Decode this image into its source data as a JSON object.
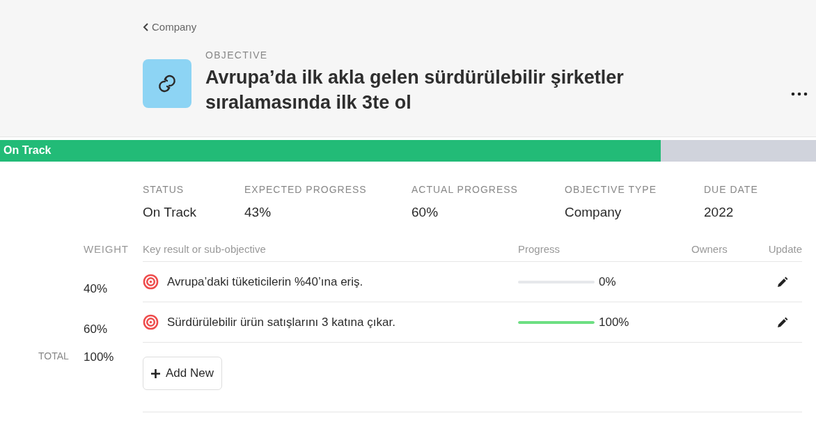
{
  "breadcrumb": {
    "label": "Company"
  },
  "objective": {
    "eyebrow": "OBJECTIVE",
    "title": "Avrupa’da ilk akla gelen sürdürülebilir şirketler sıralamasında ilk 3te ol"
  },
  "status_bar": {
    "label": "On Track",
    "level": 0.81
  },
  "summary": [
    {
      "label": "STATUS",
      "value": "On Track"
    },
    {
      "label": "EXPECTED PROGRESS",
      "value": "43%"
    },
    {
      "label": "ACTUAL PROGRESS",
      "value": "60%"
    },
    {
      "label": "OBJECTIVE TYPE",
      "value": "Company"
    },
    {
      "label": "DUE DATE",
      "value": "2022"
    }
  ],
  "table": {
    "columns": [
      "WEIGHT",
      "Key result or sub-objective",
      "Progress",
      "Owners",
      "Update"
    ],
    "rows": [
      {
        "weight": "40%",
        "title": "Avrupa’daki tüketicilerin %40’ına eriş.",
        "level": 0,
        "reading": "0%"
      },
      {
        "weight": "60%",
        "title": "Sürdürülebilir ürün satışlarını 3 katına çıkar.",
        "level": 1,
        "reading": "100%"
      }
    ],
    "total": {
      "label": "TOTAL",
      "value": "100%"
    },
    "add_button": "Add New"
  }
}
